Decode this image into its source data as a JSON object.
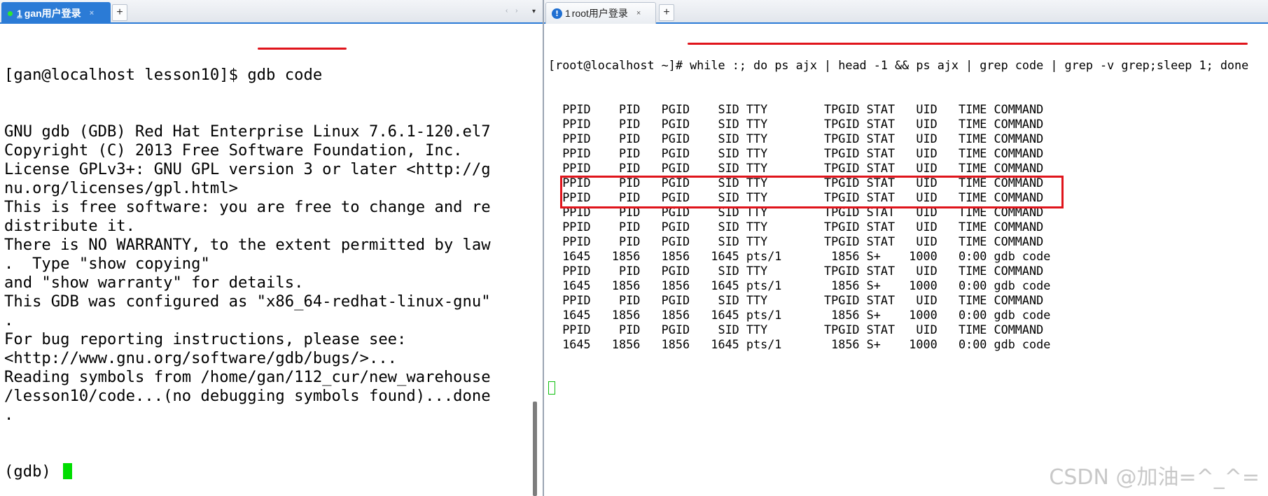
{
  "left_tab": {
    "number": "1",
    "title": "gan用户登录",
    "close": "×",
    "add": "+",
    "nav": "‹ ›",
    "menu": "▾"
  },
  "right_tab": {
    "info_glyph": "!",
    "number": "1",
    "title": "root用户登录",
    "close": "×",
    "add": "+"
  },
  "left_terminal": {
    "prompt": "[gan@localhost lesson10]$ ",
    "command": "gdb code",
    "output_lines": [
      "GNU gdb (GDB) Red Hat Enterprise Linux 7.6.1-120.el7",
      "Copyright (C) 2013 Free Software Foundation, Inc.",
      "License GPLv3+: GNU GPL version 3 or later <http://g",
      "nu.org/licenses/gpl.html>",
      "This is free software: you are free to change and re",
      "distribute it.",
      "There is NO WARRANTY, to the extent permitted by law",
      ".  Type \"show copying\"",
      "and \"show warranty\" for details.",
      "This GDB was configured as \"x86_64-redhat-linux-gnu\"",
      ".",
      "For bug reporting instructions, please see:",
      "<http://www.gnu.org/software/gdb/bugs/>...",
      "Reading symbols from /home/gan/112_cur/new_warehouse",
      "/lesson10/code...(no debugging symbols found)...done",
      "."
    ],
    "gdb_prompt": "(gdb) "
  },
  "right_terminal": {
    "prompt": "[root@localhost ~]# ",
    "command": "while :; do ps ajx | head -1 && ps ajx | grep code | grep -v grep;sleep 1; done",
    "header": "  PPID    PID   PGID    SID TTY        TPGID STAT   UID   TIME COMMAND",
    "process": "  1645   1856   1856   1645 pts/1       1856 S+    1000   0:00 gdb code",
    "lines": [
      "  PPID    PID   PGID    SID TTY        TPGID STAT   UID   TIME COMMAND",
      "  PPID    PID   PGID    SID TTY        TPGID STAT   UID   TIME COMMAND",
      "  PPID    PID   PGID    SID TTY        TPGID STAT   UID   TIME COMMAND",
      "  PPID    PID   PGID    SID TTY        TPGID STAT   UID   TIME COMMAND",
      "  PPID    PID   PGID    SID TTY        TPGID STAT   UID   TIME COMMAND",
      "  PPID    PID   PGID    SID TTY        TPGID STAT   UID   TIME COMMAND",
      "  PPID    PID   PGID    SID TTY        TPGID STAT   UID   TIME COMMAND",
      "  PPID    PID   PGID    SID TTY        TPGID STAT   UID   TIME COMMAND",
      "  PPID    PID   PGID    SID TTY        TPGID STAT   UID   TIME COMMAND",
      "  PPID    PID   PGID    SID TTY        TPGID STAT   UID   TIME COMMAND",
      "  1645   1856   1856   1645 pts/1       1856 S+    1000   0:00 gdb code",
      "  PPID    PID   PGID    SID TTY        TPGID STAT   UID   TIME COMMAND",
      "  1645   1856   1856   1645 pts/1       1856 S+    1000   0:00 gdb code",
      "  PPID    PID   PGID    SID TTY        TPGID STAT   UID   TIME COMMAND",
      "  1645   1856   1856   1645 pts/1       1856 S+    1000   0:00 gdb code",
      "  PPID    PID   PGID    SID TTY        TPGID STAT   UID   TIME COMMAND",
      "  1645   1856   1856   1645 pts/1       1856 S+    1000   0:00 gdb code"
    ]
  },
  "watermark": "CSDN @加油=^_^=",
  "colors": {
    "annotation_red": "#e0141b",
    "cursor_green": "#00dd00",
    "tab_active_blue": "#2b7bd6"
  }
}
